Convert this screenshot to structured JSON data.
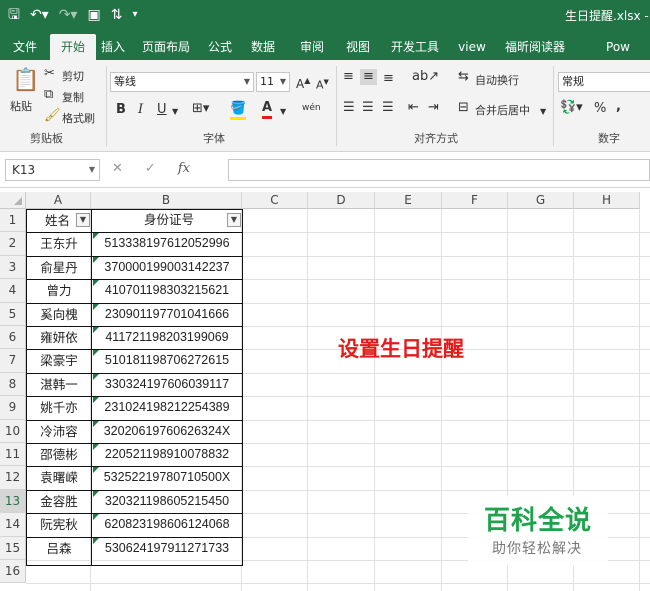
{
  "window": {
    "title": "生日提醒.xlsx  -"
  },
  "qat": {
    "save_icon": "save-icon",
    "undo_icon": "undo-icon",
    "redo_icon": "redo-icon",
    "preview_icon": "print-preview-icon",
    "sort_icon": "sort-icon"
  },
  "tabs": [
    "文件",
    "开始",
    "插入",
    "页面布局",
    "公式",
    "数据",
    "审阅",
    "视图",
    "开发工具",
    "view",
    "福昕阅读器",
    "Pow"
  ],
  "active_tab": "开始",
  "ribbon": {
    "clipboard": {
      "paste": "粘贴",
      "cut": "剪切",
      "copy": "复制",
      "format_painter": "格式刷",
      "label": "剪贴板"
    },
    "font": {
      "name": "等线",
      "size": "11",
      "grow": "A",
      "shrink": "A",
      "bold": "B",
      "italic": "I",
      "underline": "U",
      "phonetic": "wén",
      "label": "字体"
    },
    "alignment": {
      "wrap": "自动换行",
      "merge": "合并后居中",
      "label": "对齐方式"
    },
    "number": {
      "format": "常规",
      "percent": "%",
      "comma": ",",
      "label": "数字"
    }
  },
  "formula_bar": {
    "name_box": "K13",
    "fx": "fx",
    "value": ""
  },
  "columns": [
    "A",
    "B",
    "C",
    "D",
    "E",
    "F",
    "G",
    "H"
  ],
  "rows": [
    "1",
    "2",
    "3",
    "4",
    "5",
    "6",
    "7",
    "8",
    "9",
    "10",
    "11",
    "12",
    "13",
    "14",
    "15",
    "16"
  ],
  "selected_row": "13",
  "headers": {
    "name": "姓名",
    "id": "身份证号"
  },
  "people": [
    {
      "name": "王东升",
      "id": "513338197612052996"
    },
    {
      "name": "俞星丹",
      "id": "370000199003142237"
    },
    {
      "name": "曾力",
      "id": "410701198303215621"
    },
    {
      "name": "奚向槐",
      "id": "230901197701041666"
    },
    {
      "name": "雍妍依",
      "id": "411721198203199069"
    },
    {
      "name": "梁豪宇",
      "id": "510181198706272615"
    },
    {
      "name": "湛韩一",
      "id": "330324197606039117"
    },
    {
      "name": "姚千亦",
      "id": "231024198212254389"
    },
    {
      "name": "冷沛容",
      "id": "32020619760626324X"
    },
    {
      "name": "邵德彬",
      "id": "220521198910078832"
    },
    {
      "name": "袁曙嵘",
      "id": "53252219780710500X"
    },
    {
      "name": "金容胜",
      "id": "320321198605215450"
    },
    {
      "name": "阮宪秋",
      "id": "620823198606124068"
    },
    {
      "name": "吕森",
      "id": "530624197911271733"
    }
  ],
  "annotation": "设置生日提醒",
  "watermark": {
    "main": "百科全说",
    "sub": "助你轻松解决"
  },
  "colors": {
    "excel_green": "#217346",
    "annotation_red": "#e21b1b",
    "logo_green": "#1ea34c"
  }
}
